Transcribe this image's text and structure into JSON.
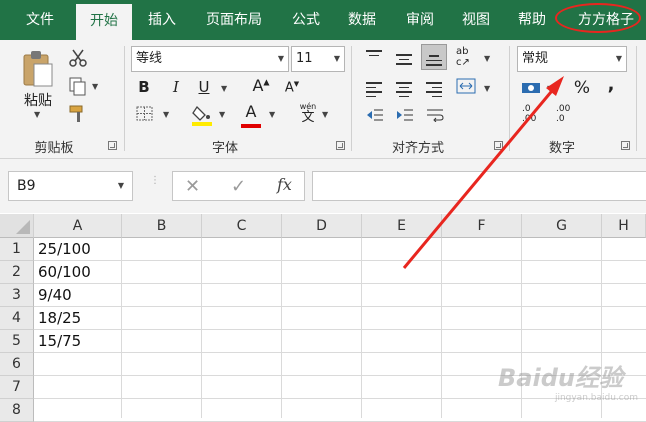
{
  "tabs": [
    {
      "label": "文件"
    },
    {
      "label": "开始"
    },
    {
      "label": "插入"
    },
    {
      "label": "页面布局"
    },
    {
      "label": "公式"
    },
    {
      "label": "数据"
    },
    {
      "label": "审阅"
    },
    {
      "label": "视图"
    },
    {
      "label": "帮助"
    },
    {
      "label": "方方格子"
    }
  ],
  "active_tab": "开始",
  "clipboard": {
    "paste_label": "粘贴",
    "group_label": "剪贴板"
  },
  "font": {
    "font_name": "等线",
    "font_size": "11",
    "bold": "B",
    "italic": "I",
    "underline": "U",
    "grow": "A",
    "shrink": "A",
    "font_color_letter": "A",
    "phonetic": "wén",
    "phonetic_char": "文",
    "group_label": "字体",
    "fill_color": "#ffeb00",
    "font_color": "#e00000"
  },
  "alignment": {
    "group_label": "对齐方式"
  },
  "number": {
    "format": "常规",
    "percent": "%",
    "comma": ",",
    "group_label": "数字",
    "inc_top": ".0",
    "inc_bottom": ".00",
    "dec_top": ".00",
    "dec_bottom": ".0"
  },
  "formula_bar": {
    "name_box": "B9",
    "fx": "fx",
    "value": ""
  },
  "columns": [
    "A",
    "B",
    "C",
    "D",
    "E",
    "F",
    "G",
    "H"
  ],
  "rows": [
    "1",
    "2",
    "3",
    "4",
    "5",
    "6",
    "7",
    "8"
  ],
  "cells_A": [
    "25/100",
    "60/100",
    "9/40",
    "18/25",
    "15/75",
    "",
    "",
    ""
  ],
  "watermark": {
    "text": "Baidu经验",
    "sub": "jingyan.baidu.com"
  },
  "colors": {
    "ribbon_green": "#217346",
    "annotation_red": "#e8261f"
  }
}
